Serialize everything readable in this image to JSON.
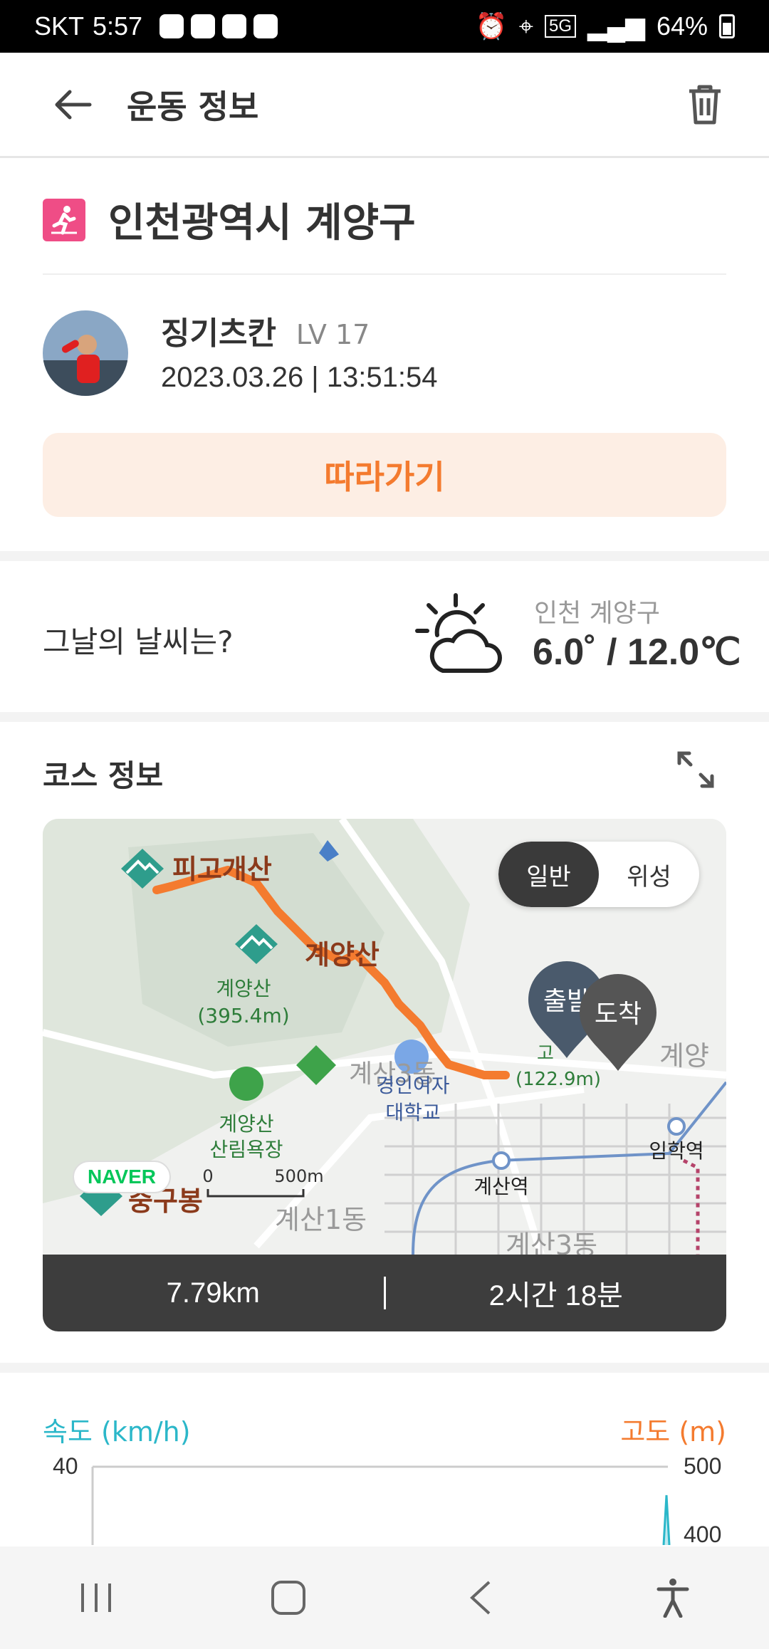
{
  "status_bar": {
    "carrier": "SKT",
    "time": "5:57",
    "network": "5G",
    "battery": "64%"
  },
  "header": {
    "title": "운동 정보"
  },
  "activity": {
    "location": "인천광역시 계양구",
    "user_name": "징기츠칸",
    "user_level": "LV 17",
    "datetime": "2023.03.26 | 13:51:54",
    "follow_label": "따라가기"
  },
  "weather": {
    "label": "그날의 날씨는?",
    "location": "인천 계양구",
    "temp": "6.0˚ / 12.0℃"
  },
  "course": {
    "title": "코스 정보",
    "map_toggle": [
      "일반",
      "위성"
    ],
    "map_labels": {
      "peak1": "피고개산",
      "peak2": "계양산",
      "peak2_sub1": "계양산",
      "peak2_sub2": "(395.4m)",
      "forest1": "계양산",
      "forest2": "산림욕장",
      "univ1": "경인여자",
      "univ2": "대학교",
      "gyesan3": "계산3동",
      "gyesan1": "계산1동",
      "gyesan3b": "계산3동",
      "gyeyang": "계양",
      "station1": "계산역",
      "station2": "임학역",
      "peak3": "중구봉",
      "scale0": "0",
      "scale500": "500m",
      "start": "출발",
      "end": "도착",
      "alt_label1": "고",
      "alt_label2": "(122.9m)"
    },
    "naver": "NAVER",
    "distance": "7.79km",
    "duration": "2시간 18분"
  },
  "chart": {
    "left_label": "속도 (km/h)",
    "right_label": "고도 (m)",
    "left_tick": "40",
    "right_tick1": "500",
    "right_tick2": "400"
  },
  "colors": {
    "accent": "#f47b2f",
    "speed": "#2bb7c9",
    "walk_badge": "#ef4d86"
  }
}
